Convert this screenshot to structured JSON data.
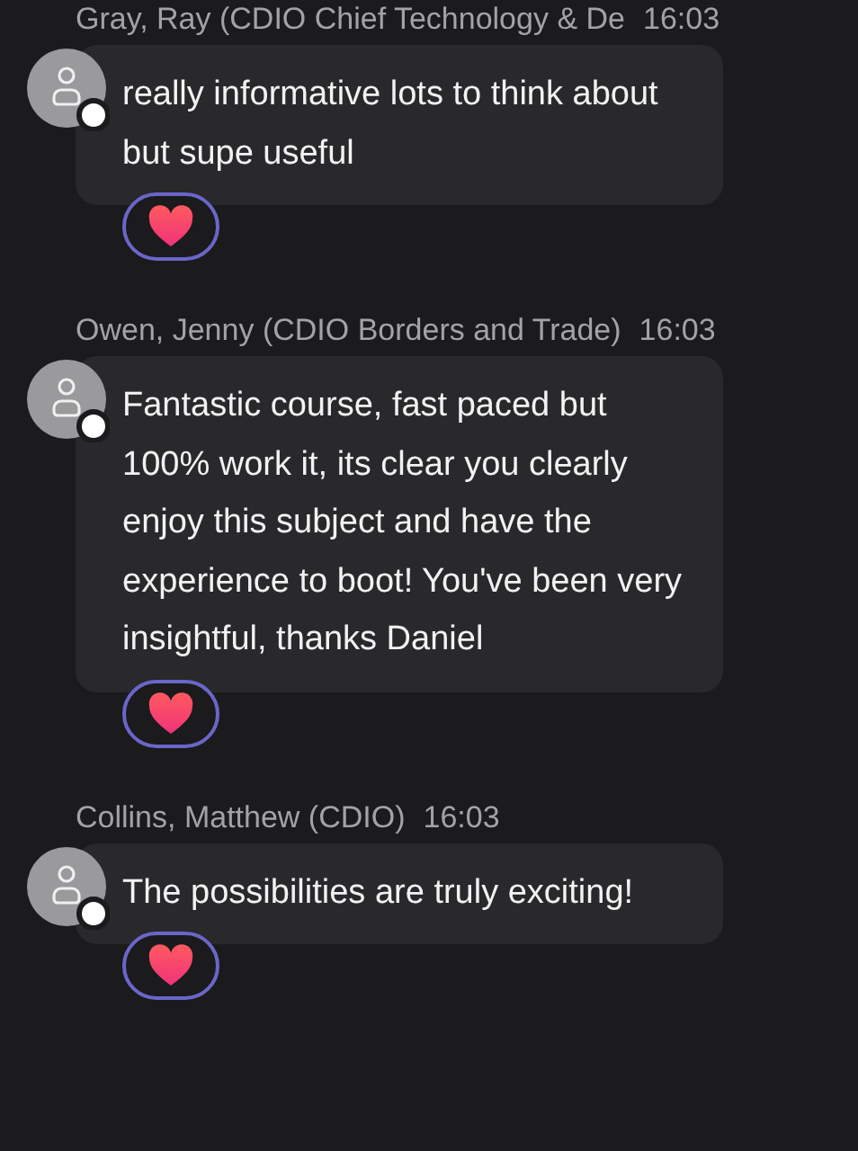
{
  "messages": [
    {
      "author": "Gray, Ray (CDIO Chief Technology & De",
      "time": "16:03",
      "text": "really informative lots to think about but supe useful",
      "reaction": {
        "selected": true
      }
    },
    {
      "author": "Owen, Jenny (CDIO Borders and Trade)",
      "time": "16:03",
      "text": "Fantastic course, fast paced but 100% work it, its clear you clearly enjoy this subject and have the experience to boot! You've been very insightful, thanks Daniel",
      "reaction": {
        "selected": true
      }
    },
    {
      "author": "Collins, Matthew (CDIO)",
      "time": "16:03",
      "text": "The possibilities are truly exciting!",
      "reaction": {
        "selected": true
      }
    }
  ]
}
